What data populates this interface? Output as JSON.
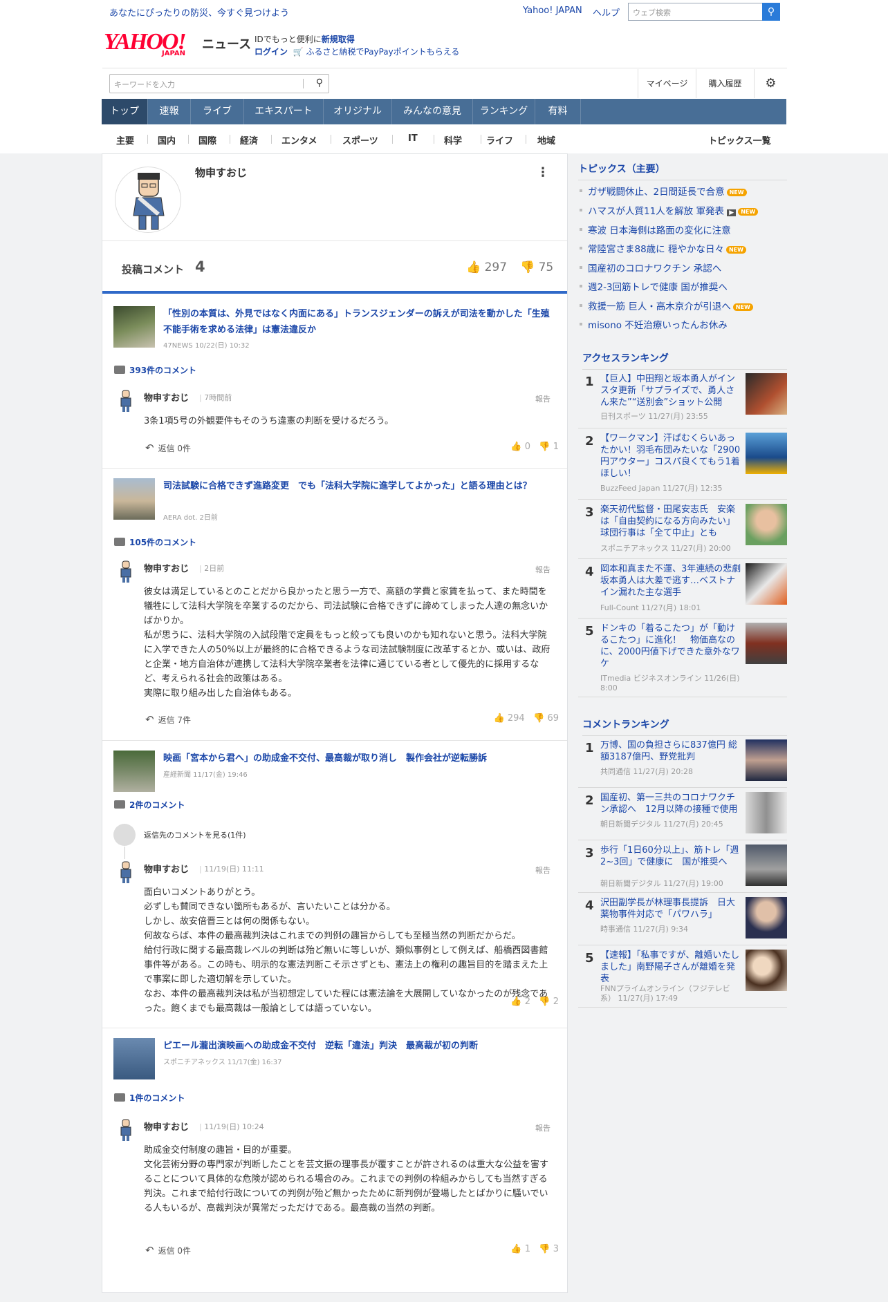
{
  "header": {
    "promo": "あなたにぴったりの防災、今すぐ見つけよう",
    "links": [
      "Yahoo! JAPAN",
      "ヘルプ"
    ],
    "web_search_placeholder": "ウェブ検索",
    "logo_text": "YAHOO!",
    "logo_sub": "JAPAN",
    "news_label": "ニュース",
    "id_text": "IDでもっと便利に",
    "id_link": "新規取得",
    "login": "ログイン",
    "furusato": "ふるさと納税でPayPayポイントもらえる",
    "keyword_placeholder": "キーワードを入力",
    "mypage": "マイページ",
    "history": "購入履歴"
  },
  "global_nav": [
    "トップ",
    "速報",
    "ライブ",
    "エキスパート",
    "オリジナル",
    "みんなの意見",
    "ランキング",
    "有料"
  ],
  "sub_nav": [
    "主要",
    "国内",
    "国際",
    "経済",
    "エンタメ",
    "スポーツ",
    "IT",
    "科学",
    "ライフ",
    "地域"
  ],
  "sub_nav_right": "トピックス一覧",
  "profile": {
    "name": "物申すおじ",
    "comments_label": "投稿コメント",
    "comments_count": "4",
    "likes": "297",
    "dislikes": "75"
  },
  "cards": [
    {
      "title": "「性別の本質は、外見ではなく内面にある」トランスジェンダーの訴えが司法を動かした「生殖不能手術を求める法律」は憲法違反か",
      "source": "47NEWS 10/22(日) 10:32",
      "comment_count": "393件のコメント",
      "author": "物申すおじ",
      "time": "7時間前",
      "report": "報告",
      "text": [
        "3条1項5号の外観要件もそのうち違憲の判断を受けるだろう。"
      ],
      "reply": "返信 0件",
      "up": "0",
      "down": "1"
    },
    {
      "title": "司法試験に合格できず進路変更　でも「法科大学院に進学してよかった」と語る理由とは？",
      "source": "AERA dot. 2日前",
      "comment_count": "105件のコメント",
      "author": "物申すおじ",
      "time": "2日前",
      "report": "報告",
      "text": [
        "彼女は満足しているとのことだから良かったと思う一方で、高額の学費と家賃を払って、また時間を犠牲にして法科大学院を卒業するのだから、司法試験に合格できずに諦めてしまった人達の無念いかばかりか。",
        "私が思うに、法科大学院の入試段階で定員をもっと絞っても良いのかも知れないと思う。法科大学院に入学できた人の50%以上が最終的に合格できるような司法試験制度に改革するとか、或いは、政府と企業・地方自治体が連携して法科大学院卒業者を法律に通じている者として優先的に採用するなど、考えられる社会的政策はある。",
        "実際に取り組み出した自治体もある。"
      ],
      "reply": "返信 7件",
      "up": "294",
      "down": "69"
    },
    {
      "title": "映画「宮本から君へ」の助成金不交付、最高裁が取り消し　製作会社が逆転勝訴",
      "source": "産経新聞 11/17(金) 19:46",
      "comment_count": "2件のコメント",
      "see_reply": "返信先のコメントを見る(1件)",
      "author": "物申すおじ",
      "time": "11/19(日) 11:11",
      "report": "報告",
      "text": [
        "面白いコメントありがとう。",
        "必ずしも賛同できない箇所もあるが、言いたいことは分かる。",
        "しかし、故安倍晋三とは何の関係もない。",
        "何故ならば、本件の最高裁判決はこれまでの判例の趣旨からしても至極当然の判断だからだ。",
        "給付行政に関する最高裁レベルの判断は殆ど無いに等しいが、類似事例として例えば、船橋西図書館事件等がある。この時も、明示的な憲法判断こそ示さずとも、憲法上の権利の趣旨目的を踏まえた上で事案に即した適切解を示していた。",
        "なお、本件の最高裁判決は私が当初想定していた程には憲法論を大展開していなかったのが残念であった。飽くまでも最高裁は一般論としては語っていない。"
      ],
      "up": "2",
      "down": "2"
    },
    {
      "title": "ピエール瀧出演映画への助成金不交付　逆転「違法」判決　最高裁が初の判断",
      "source": "スポニチアネックス 11/17(金) 16:37",
      "comment_count": "1件のコメント",
      "author": "物申すおじ",
      "time": "11/19(日) 10:24",
      "report": "報告",
      "text": [
        "助成金交付制度の趣旨・目的が重要。",
        "文化芸術分野の専門家が判断したことを芸文振の理事長が覆すことが許されるのは重大な公益を害することについて具体的な危険が認められる場合のみ。これまでの判例の枠組みからしても当然すぎる判決。これまで給付行政についての判例が殆ど無かったために新判例が登場したとばかりに騒いでいる人もいるが、高裁判決が異常だっただけである。最高裁の当然の判断。"
      ],
      "reply": "返信 0件",
      "up": "1",
      "down": "3"
    }
  ],
  "sidebar": {
    "topics_title": "トピックス（主要）",
    "topics": [
      {
        "text": "ガザ戦闘休止、2日間延長で合意",
        "new": true,
        "video": false
      },
      {
        "text": "ハマスが人質11人を解放 軍発表",
        "new": true,
        "video": true
      },
      {
        "text": "寒波 日本海側は路面の変化に注意",
        "new": false,
        "video": false
      },
      {
        "text": "常陸宮さま88歳に 穏やかな日々",
        "new": true,
        "video": false
      },
      {
        "text": "国産初のコロナワクチン 承認へ",
        "new": false,
        "video": false
      },
      {
        "text": "週2-3回筋トレで健康 国が推奨へ",
        "new": false,
        "video": false
      },
      {
        "text": "救援一筋 巨人・高木京介が引退へ",
        "new": true,
        "video": false
      },
      {
        "text": "misono 不妊治療いったんお休み",
        "new": false,
        "video": false
      }
    ],
    "new_label": "NEW",
    "access_title": "アクセスランキング",
    "access": [
      {
        "rank": "1",
        "title": "【巨人】中田翔と坂本勇人がインスタ更新「サプライズで、勇人さん来た”“送別会”ショット公開",
        "source": "日刊スポーツ 11/27(月) 23:55"
      },
      {
        "rank": "2",
        "title": "【ワークマン】汗ばむくらいあったかい！羽毛布団みたいな「2900円アウター」コスパ良くてもう1着ほしい！",
        "source": "BuzzFeed Japan 11/27(月) 12:35"
      },
      {
        "rank": "3",
        "title": "楽天初代監督・田尾安志氏　安楽は「自由契約になる方向みたい」球団行事は「全て中止」とも",
        "source": "スポニチアネックス 11/27(月) 20:00"
      },
      {
        "rank": "4",
        "title": "岡本和真また不運、3年連続の悲劇　坂本勇人は大差で逃す…ベストナイン漏れた主な選手",
        "source": "Full-Count 11/27(月) 18:01"
      },
      {
        "rank": "5",
        "title": "ドンキの「着るこたつ」が「動けるこたつ」に進化！　物価高なのに、2000円値下げできた意外なワケ",
        "source": "ITmedia ビジネスオンライン 11/26(日) 8:00"
      }
    ],
    "comment_title": "コメントランキング",
    "comment_rank": [
      {
        "rank": "1",
        "title": "万博、国の負担さらに837億円 総額3187億円、野党批判",
        "source": "共同通信 11/27(月) 20:28"
      },
      {
        "rank": "2",
        "title": "国産初、第一三共のコロナワクチン承認へ　12月以降の接種で使用",
        "source": "朝日新聞デジタル 11/27(月) 20:45"
      },
      {
        "rank": "3",
        "title": "歩行「1日60分以上」、筋トレ「週2~3回」で健康に　国が推奨へ",
        "source": "朝日新聞デジタル 11/27(月) 19:00"
      },
      {
        "rank": "4",
        "title": "沢田副学長が林理事長提訴　日大薬物事件対応で「パワハラ」",
        "source": "時事通信 11/27(月) 9:34"
      },
      {
        "rank": "5",
        "title": "【速報】「私事ですが、離婚いたしました」南野陽子さんが離婚を発表",
        "source": "FNNプライムオンライン（フジテレビ系） 11/27(月) 17:49"
      }
    ]
  }
}
